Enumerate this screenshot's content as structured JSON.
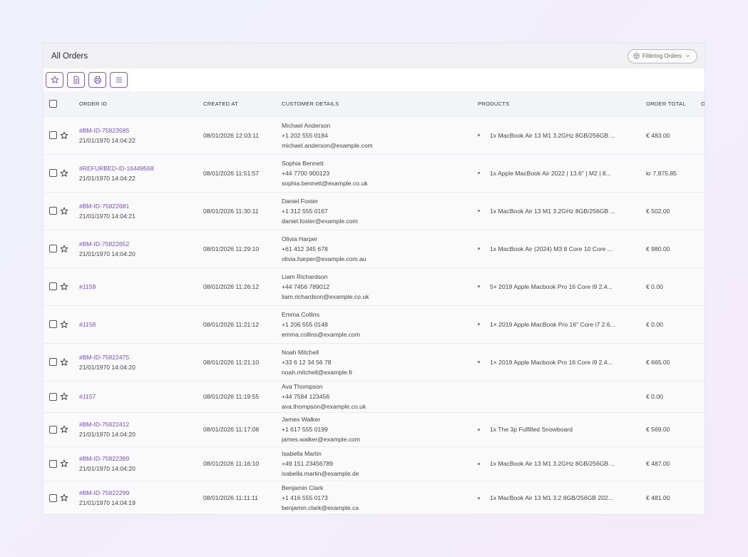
{
  "header": {
    "title": "All Orders",
    "filter_label": "Filtering Orders"
  },
  "toolbar": {
    "buttons": [
      {
        "name": "favorite-toolbar-button",
        "icon": "star-icon"
      },
      {
        "name": "export-button",
        "icon": "document-icon"
      },
      {
        "name": "print-button",
        "icon": "printer-icon"
      },
      {
        "name": "columns-menu-button",
        "icon": "menu-icon"
      }
    ]
  },
  "accent_color": "#7a4fdc",
  "table": {
    "columns": {
      "order_id": "ORDER ID",
      "created_at": "CREATED AT",
      "customer": "CUSTOMER DETAILS",
      "products": "PRODUCTS",
      "order_total": "ORDER TOTAL",
      "next": "O"
    },
    "rows": [
      {
        "id": "#BM-ID-75823585",
        "date": "21/01/1970 14:04:22",
        "created": "08/01/2026 12:03:11",
        "name": "Michael Anderson",
        "phone": "+1 202 555 0184",
        "email": "michael.anderson@example.com",
        "product": "1x MacBook Air 13 M1 3.2GHz 8GB/256GB ...",
        "total": "€ 483.00"
      },
      {
        "id": "#REFURBED-ID-16449568",
        "date": "21/01/1970 14:04:22",
        "created": "08/01/2026 11:51:57",
        "name": "Sophia Bennett",
        "phone": "+44 7700 900123",
        "email": "sophia.bennett@example.co.uk",
        "product": "1x Apple MacBook Air 2022 | 13.6\" | M2 | 8...",
        "total": "kr 7,875.85"
      },
      {
        "id": "#BM-ID-75822681",
        "date": "21/01/1970 14:04:21",
        "created": "08/01/2026 11:30:11",
        "name": "Daniel Foster",
        "phone": "+1 312 555 0167",
        "email": "daniel.foster@example.com",
        "product": "1x MacBook Air 13 M1 3.2GHz 8GB/256GB ...",
        "total": "€ 502.00"
      },
      {
        "id": "#BM-ID-75822652",
        "date": "21/01/1970 14:04:20",
        "created": "08/01/2026 11:29:10",
        "name": "Olivia Harper",
        "phone": "+61 412 345 678",
        "email": "olivia.harper@example.com.au",
        "product": "1x MacBook Air (2024) M3 8 Core 10 Core ...",
        "total": "€ 980.00"
      },
      {
        "id": "#1159",
        "date": "",
        "created": "08/01/2026 11:26:12",
        "name": "Liam Richardson",
        "phone": "+44 7456 789012",
        "email": "liam.richardson@example.co.uk",
        "product": "5× 2019 Apple Macbook Pro 16 Core i9 2.4...",
        "total": "€ 0.00"
      },
      {
        "id": "#1158",
        "date": "",
        "created": "08/01/2026 11:21:12",
        "name": "Emma Collins",
        "phone": "+1 206 555 0148",
        "email": "emma.collins@example.com",
        "product": "1× 2019 Apple MacBook Pro 16\" Core i7 2.6...",
        "total": "€ 0.00"
      },
      {
        "id": "#BM-ID-75822475",
        "date": "21/01/1970 14:04:20",
        "created": "08/01/2026 11:21:10",
        "name": "Noah Mitchell",
        "phone": "+33 6 12 34 56 78",
        "email": "noah.mitchell@example.fr",
        "product": "1× 2019 Apple Macbook Pro 16 Core i9 2.4...",
        "total": "€ 665.00"
      },
      {
        "id": "#1157",
        "date": "",
        "created": "08/01/2026 11:19:55",
        "name": "Ava Thompson",
        "phone": "+44 7584 123456",
        "email": "ava.thompson@example.co.uk",
        "product": "-",
        "total": "€ 0.00"
      },
      {
        "id": "#BM-ID-75822412",
        "date": "21/01/1970 14:04:20",
        "created": "08/01/2026 11:17:08",
        "name": "James Walker",
        "phone": "+1 617 555 0199",
        "email": "james.walker@example.com",
        "product": "1x The 3p Fulfilled Snowboard",
        "total": "€ 569.00"
      },
      {
        "id": "#BM-ID-75822389",
        "date": "21/01/1970 14:04:20",
        "created": "08/01/2026 11:16:10",
        "name": "Isabella Martin",
        "phone": "+49 151 23456789",
        "email": "isabella.martin@example.de",
        "product": "1x MacBook Air 13 M1 3.2GHz 8GB/256GB ...",
        "total": "€ 487.00"
      },
      {
        "id": "#BM-ID-75822299",
        "date": "21/01/1970 14:04:19",
        "created": "08/01/2026 11:11:11",
        "name": "Benjamin Clark",
        "phone": "+1 416 555 0173",
        "email": "benjamin.clark@example.ca",
        "product": "1x MacBook Air 13 M1 3.2 8GB/256GB 202...",
        "total": "€ 481.00"
      }
    ]
  }
}
